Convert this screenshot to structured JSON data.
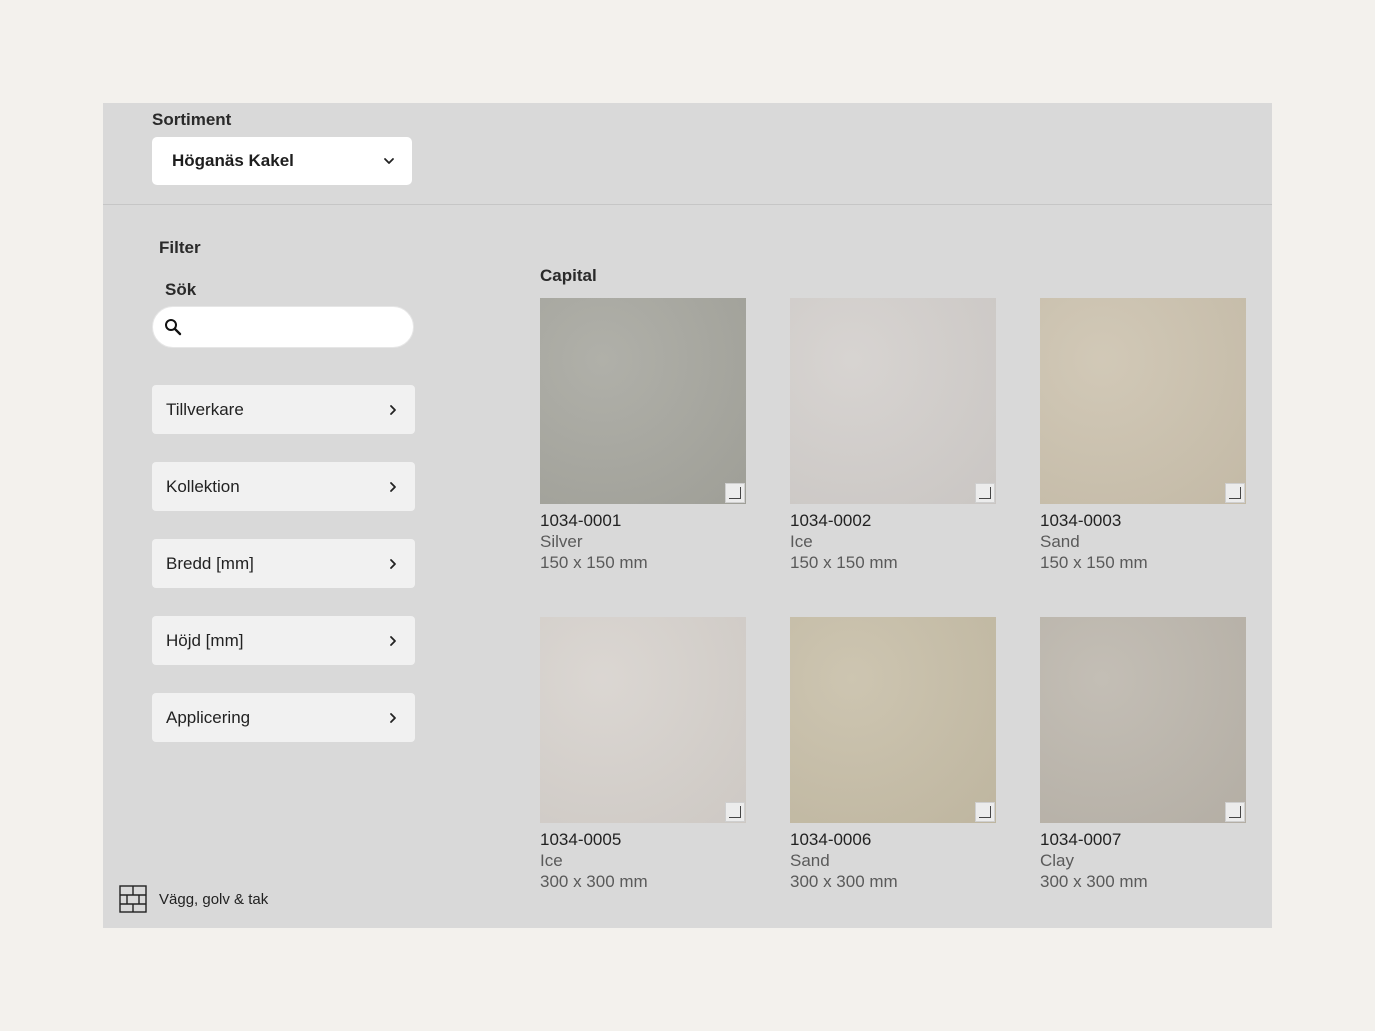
{
  "assortment": {
    "label": "Sortiment",
    "selected": "Höganäs Kakel"
  },
  "filter": {
    "title": "Filter",
    "search_label": "Sök",
    "search_value": "",
    "facets": [
      {
        "label": "Tillverkare"
      },
      {
        "label": "Kollektion"
      },
      {
        "label": "Bredd [mm]"
      },
      {
        "label": "Höjd [mm]"
      },
      {
        "label": "Applicering"
      }
    ]
  },
  "collection": {
    "title": "Capital",
    "products": [
      {
        "code": "1034-0001",
        "color": "Silver",
        "size": "150 x 150 mm",
        "swatch": "#a5a59d"
      },
      {
        "code": "1034-0002",
        "color": "Ice",
        "size": "150 x 150 mm",
        "swatch": "#d2cecb"
      },
      {
        "code": "1034-0003",
        "color": "Sand",
        "size": "150 x 150 mm",
        "swatch": "#cbc1ad"
      },
      {
        "code": "1034-0005",
        "color": "Ice",
        "size": "300 x 300 mm",
        "swatch": "#d6d1cc"
      },
      {
        "code": "1034-0006",
        "color": "Sand",
        "size": "300 x 300 mm",
        "swatch": "#c6bda6"
      },
      {
        "code": "1034-0007",
        "color": "Clay",
        "size": "300 x 300 mm",
        "swatch": "#bbb5ab"
      }
    ]
  },
  "footer": {
    "label": "Vägg, golv & tak",
    "icon": "tile-grid-icon"
  }
}
